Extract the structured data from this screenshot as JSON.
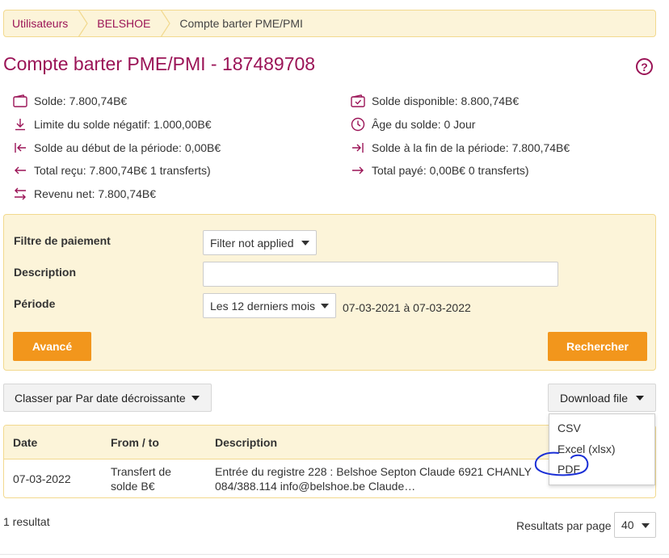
{
  "breadcrumb": {
    "items": [
      "Utilisateurs",
      "BELSHOE",
      "Compte barter PME/PMI"
    ]
  },
  "page": {
    "title": "Compte barter PME/PMI - 187489708",
    "help_label": "?"
  },
  "stats": {
    "left": [
      {
        "icon": "wallet-icon",
        "text": "Solde: 7.800,74B€"
      },
      {
        "icon": "download-arrow-icon",
        "text": "Limite du solde négatif: 1.000,00B€"
      },
      {
        "icon": "start-bar-arrow-icon",
        "text": "Solde au début de la période: 0,00B€"
      },
      {
        "icon": "arrow-left-icon",
        "text": "Total reçu: 7.800,74B€ 1 transferts)"
      },
      {
        "icon": "swap-arrows-icon",
        "text": "Revenu net: 7.800,74B€"
      }
    ],
    "right": [
      {
        "icon": "wallet-check-icon",
        "text": "Solde disponible: 8.800,74B€"
      },
      {
        "icon": "clock-icon",
        "text": "Âge du solde: 0 Jour"
      },
      {
        "icon": "end-bar-arrow-icon",
        "text": "Solde à la fin de la période: 7.800,74B€"
      },
      {
        "icon": "arrow-right-icon",
        "text": "Total payé: 0,00B€ 0 transferts)"
      }
    ]
  },
  "filters": {
    "payment_filter_label": "Filtre de paiement",
    "payment_filter_value": "Filter not applied",
    "description_label": "Description",
    "description_value": "",
    "period_label": "Période",
    "period_value": "Les 12 derniers mois",
    "period_range": "07-03-2021 à 07-03-2022",
    "advanced_button": "Avancé",
    "search_button": "Rechercher"
  },
  "toolbar": {
    "sort_label": "Classer par Par date décroissante",
    "download_label": "Download file",
    "download_options": [
      "CSV",
      "Excel (xlsx)",
      "PDF"
    ]
  },
  "table": {
    "headers": [
      "Date",
      "From / to",
      "Description"
    ],
    "rows": [
      {
        "date": "07-03-2022",
        "from_to_line1": "Transfert de",
        "from_to_line2": "solde B€",
        "description_line1": "Entrée du registre 228 : Belshoe Septon Claude 6921 CHANLY",
        "description_line2": "084/388.114 info@belshoe.be Claude…"
      }
    ]
  },
  "footer": {
    "result_count": "1 resultat",
    "per_page_label": "Resultats par page",
    "per_page_value": "40"
  },
  "colors": {
    "accent": "#9b1457",
    "panel_bg": "#fcf4d9",
    "panel_border": "#f2d98e",
    "button_orange": "#f2961c",
    "annotation_blue": "#1a2fd6"
  }
}
